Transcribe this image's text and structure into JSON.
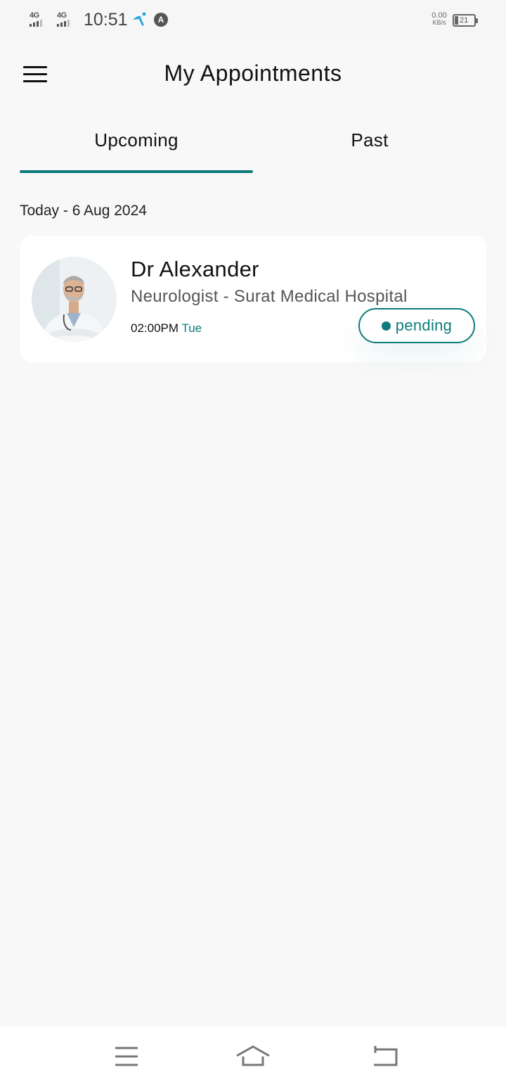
{
  "status_bar": {
    "sim1_network": "4G",
    "sim2_network": "4G",
    "time": "10:51",
    "app_icon_letter": "A",
    "net_speed_value": "0.00",
    "net_speed_unit": "KB/s",
    "battery_level": "21"
  },
  "header": {
    "title": "My Appointments",
    "menu_icon": "hamburger-menu-icon"
  },
  "tabs": [
    {
      "label": "Upcoming",
      "active": true
    },
    {
      "label": "Past",
      "active": false
    }
  ],
  "appointments": {
    "date_header": "Today - 6 Aug 2024",
    "items": [
      {
        "doctor_name": "Dr Alexander",
        "specialty_hospital": "Neurologist - Surat Medical Hospital",
        "time": "02:00PM",
        "day": "Tue",
        "status": "pending"
      }
    ]
  },
  "nav_bar": {
    "icons": [
      "recent-apps-icon",
      "home-icon",
      "back-icon"
    ]
  },
  "colors": {
    "accent": "#0f7b7b",
    "background": "#f8f8f8",
    "card": "#ffffff"
  }
}
